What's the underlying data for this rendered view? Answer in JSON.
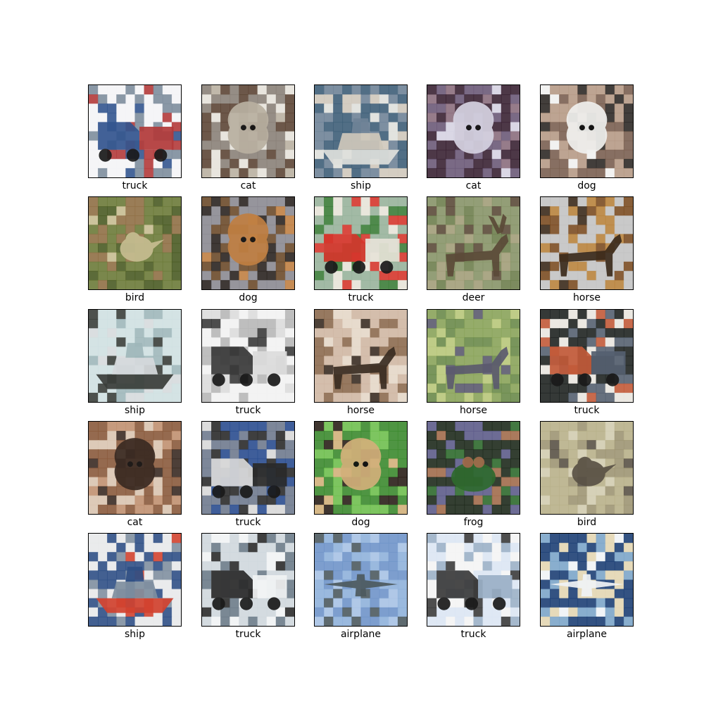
{
  "grid": {
    "items": [
      {
        "label": "truck",
        "subject": "truck",
        "palette": [
          "#f4f4f6",
          "#7d8d9c",
          "#33558f",
          "#b23a3a"
        ]
      },
      {
        "label": "cat",
        "subject": "cat",
        "palette": [
          "#8a8178",
          "#5c4535",
          "#b9b0a1",
          "#e6e2da"
        ]
      },
      {
        "label": "ship",
        "subject": "ship",
        "palette": [
          "#3e5e78",
          "#6f8397",
          "#dfe0dc",
          "#cfc8bb"
        ]
      },
      {
        "label": "cat",
        "subject": "cat",
        "palette": [
          "#3a2233",
          "#6b5a78",
          "#d6d3e2",
          "#8b6e7d"
        ]
      },
      {
        "label": "dog",
        "subject": "dog",
        "palette": [
          "#b69a86",
          "#7a5f51",
          "#f1f1ef",
          "#2d2926"
        ]
      },
      {
        "label": "bird",
        "subject": "bird",
        "palette": [
          "#6c7a39",
          "#4a5b23",
          "#c6bd91",
          "#8f6f45"
        ]
      },
      {
        "label": "dog",
        "subject": "dog",
        "palette": [
          "#8b8a91",
          "#6b4a2a",
          "#c07f42",
          "#2a2320"
        ]
      },
      {
        "label": "truck",
        "subject": "truck",
        "palette": [
          "#98b39b",
          "#3c7d39",
          "#d5362c",
          "#e7e3d8"
        ]
      },
      {
        "label": "deer",
        "subject": "deer",
        "palette": [
          "#879468",
          "#6e7e4e",
          "#5b4a38",
          "#a29d79"
        ]
      },
      {
        "label": "horse",
        "subject": "horse",
        "palette": [
          "#c3c3c3",
          "#7b4d22",
          "#3b2a1b",
          "#b8833d"
        ]
      },
      {
        "label": "ship",
        "subject": "ship",
        "palette": [
          "#cfe0e1",
          "#9fb7ba",
          "#3a3e3a",
          "#d6dadd"
        ]
      },
      {
        "label": "truck",
        "subject": "truck",
        "palette": [
          "#f2f2f2",
          "#b7b7b7",
          "#3a3a3a",
          "#dcdcdc"
        ]
      },
      {
        "label": "horse",
        "subject": "horse",
        "palette": [
          "#cfb7a3",
          "#8c6a4f",
          "#3a2c22",
          "#e4d7c8"
        ]
      },
      {
        "label": "horse",
        "subject": "horse",
        "palette": [
          "#8aa35a",
          "#6a8a4a",
          "#5b5a6e",
          "#b8c77a"
        ]
      },
      {
        "label": "truck",
        "subject": "truck",
        "palette": [
          "#1f2321",
          "#e9e6df",
          "#c25a39",
          "#556070"
        ]
      },
      {
        "label": "cat",
        "subject": "cat",
        "palette": [
          "#8a5a3c",
          "#c09070",
          "#3a2a22",
          "#d9c4b0"
        ]
      },
      {
        "label": "truck",
        "subject": "truck",
        "palette": [
          "#6f7a8e",
          "#2a4d8f",
          "#d8d8d8",
          "#2a2a2a"
        ]
      },
      {
        "label": "dog",
        "subject": "dog",
        "palette": [
          "#3c8a2f",
          "#6fbf4f",
          "#d2b07a",
          "#2a1f18"
        ]
      },
      {
        "label": "frog",
        "subject": "frog",
        "palette": [
          "#1e2a1c",
          "#5d5c8a",
          "#a16b4b",
          "#2f6a2e"
        ]
      },
      {
        "label": "bird",
        "subject": "bird",
        "palette": [
          "#b8b08a",
          "#9d9573",
          "#5a5246",
          "#d2ccb0"
        ]
      },
      {
        "label": "ship",
        "subject": "ship",
        "palette": [
          "#e8e9ea",
          "#2f4f85",
          "#d2422f",
          "#7f8fa0"
        ]
      },
      {
        "label": "truck",
        "subject": "truck",
        "palette": [
          "#cfd7dd",
          "#6b7b88",
          "#2a2a2a",
          "#f1f3f4"
        ]
      },
      {
        "label": "airplane",
        "subject": "airplane",
        "palette": [
          "#6f94c9",
          "#8fb1da",
          "#4d5a5f",
          "#a7c2e4"
        ]
      },
      {
        "label": "truck",
        "subject": "truck",
        "palette": [
          "#dce6f3",
          "#f4f4f4",
          "#3b3b3b",
          "#9bb0c7"
        ]
      },
      {
        "label": "airplane",
        "subject": "airplane",
        "palette": [
          "#1d3f74",
          "#7ca5c9",
          "#f0f3f6",
          "#e3d6b2"
        ]
      }
    ]
  }
}
